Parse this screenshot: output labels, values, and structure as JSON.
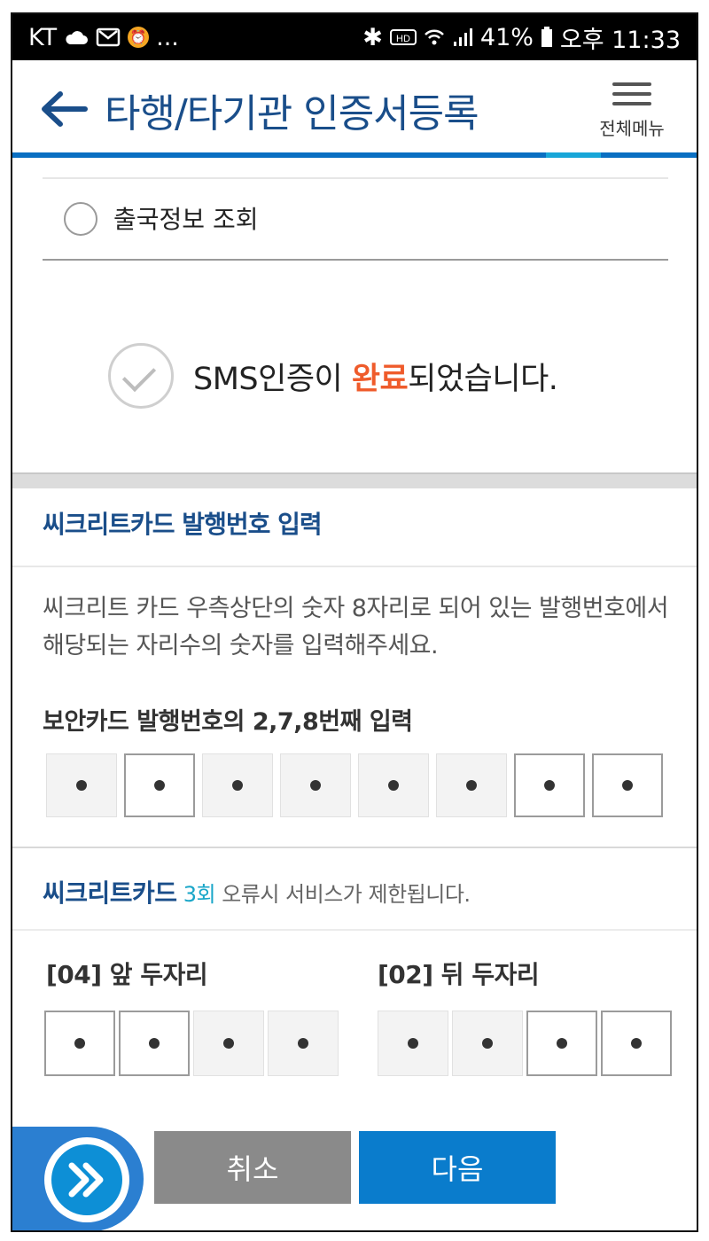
{
  "status_bar": {
    "carrier": "KT",
    "more": "...",
    "battery": "41%",
    "time": "오후 11:33"
  },
  "header": {
    "title": "타행/타기관 인증서등록",
    "menu_label": "전체메뉴"
  },
  "verification": {
    "radio_label": "출국정보 조회",
    "sms_prefix": "SMS인증이 ",
    "sms_done": "완료",
    "sms_suffix": "되었습니다."
  },
  "card_section": {
    "title": "씨크리트카드 발행번호 입력",
    "description": "씨크리트 카드 우측상단의 숫자 8자리로 되어 있는 발행번호에서 해당되는 자리수의 숫자를 입력해주세요.",
    "input_title": "보안카드 발행번호의 2,7,8번째 입력",
    "digits": [
      "filled",
      "input",
      "filled",
      "filled",
      "filled",
      "filled",
      "input",
      "input"
    ]
  },
  "warning": {
    "brand": "씨크리트카드",
    "count": "3회",
    "text": " 오류시 서비스가 제한됩니다."
  },
  "code_inputs": {
    "front_label": "[04] 앞 두자리",
    "back_label": "[02] 뒤 두자리",
    "front_digits": [
      "input",
      "input",
      "filled",
      "filled"
    ],
    "back_digits": [
      "filled",
      "filled",
      "input",
      "input"
    ]
  },
  "buttons": {
    "cancel": "취소",
    "next": "다음"
  }
}
